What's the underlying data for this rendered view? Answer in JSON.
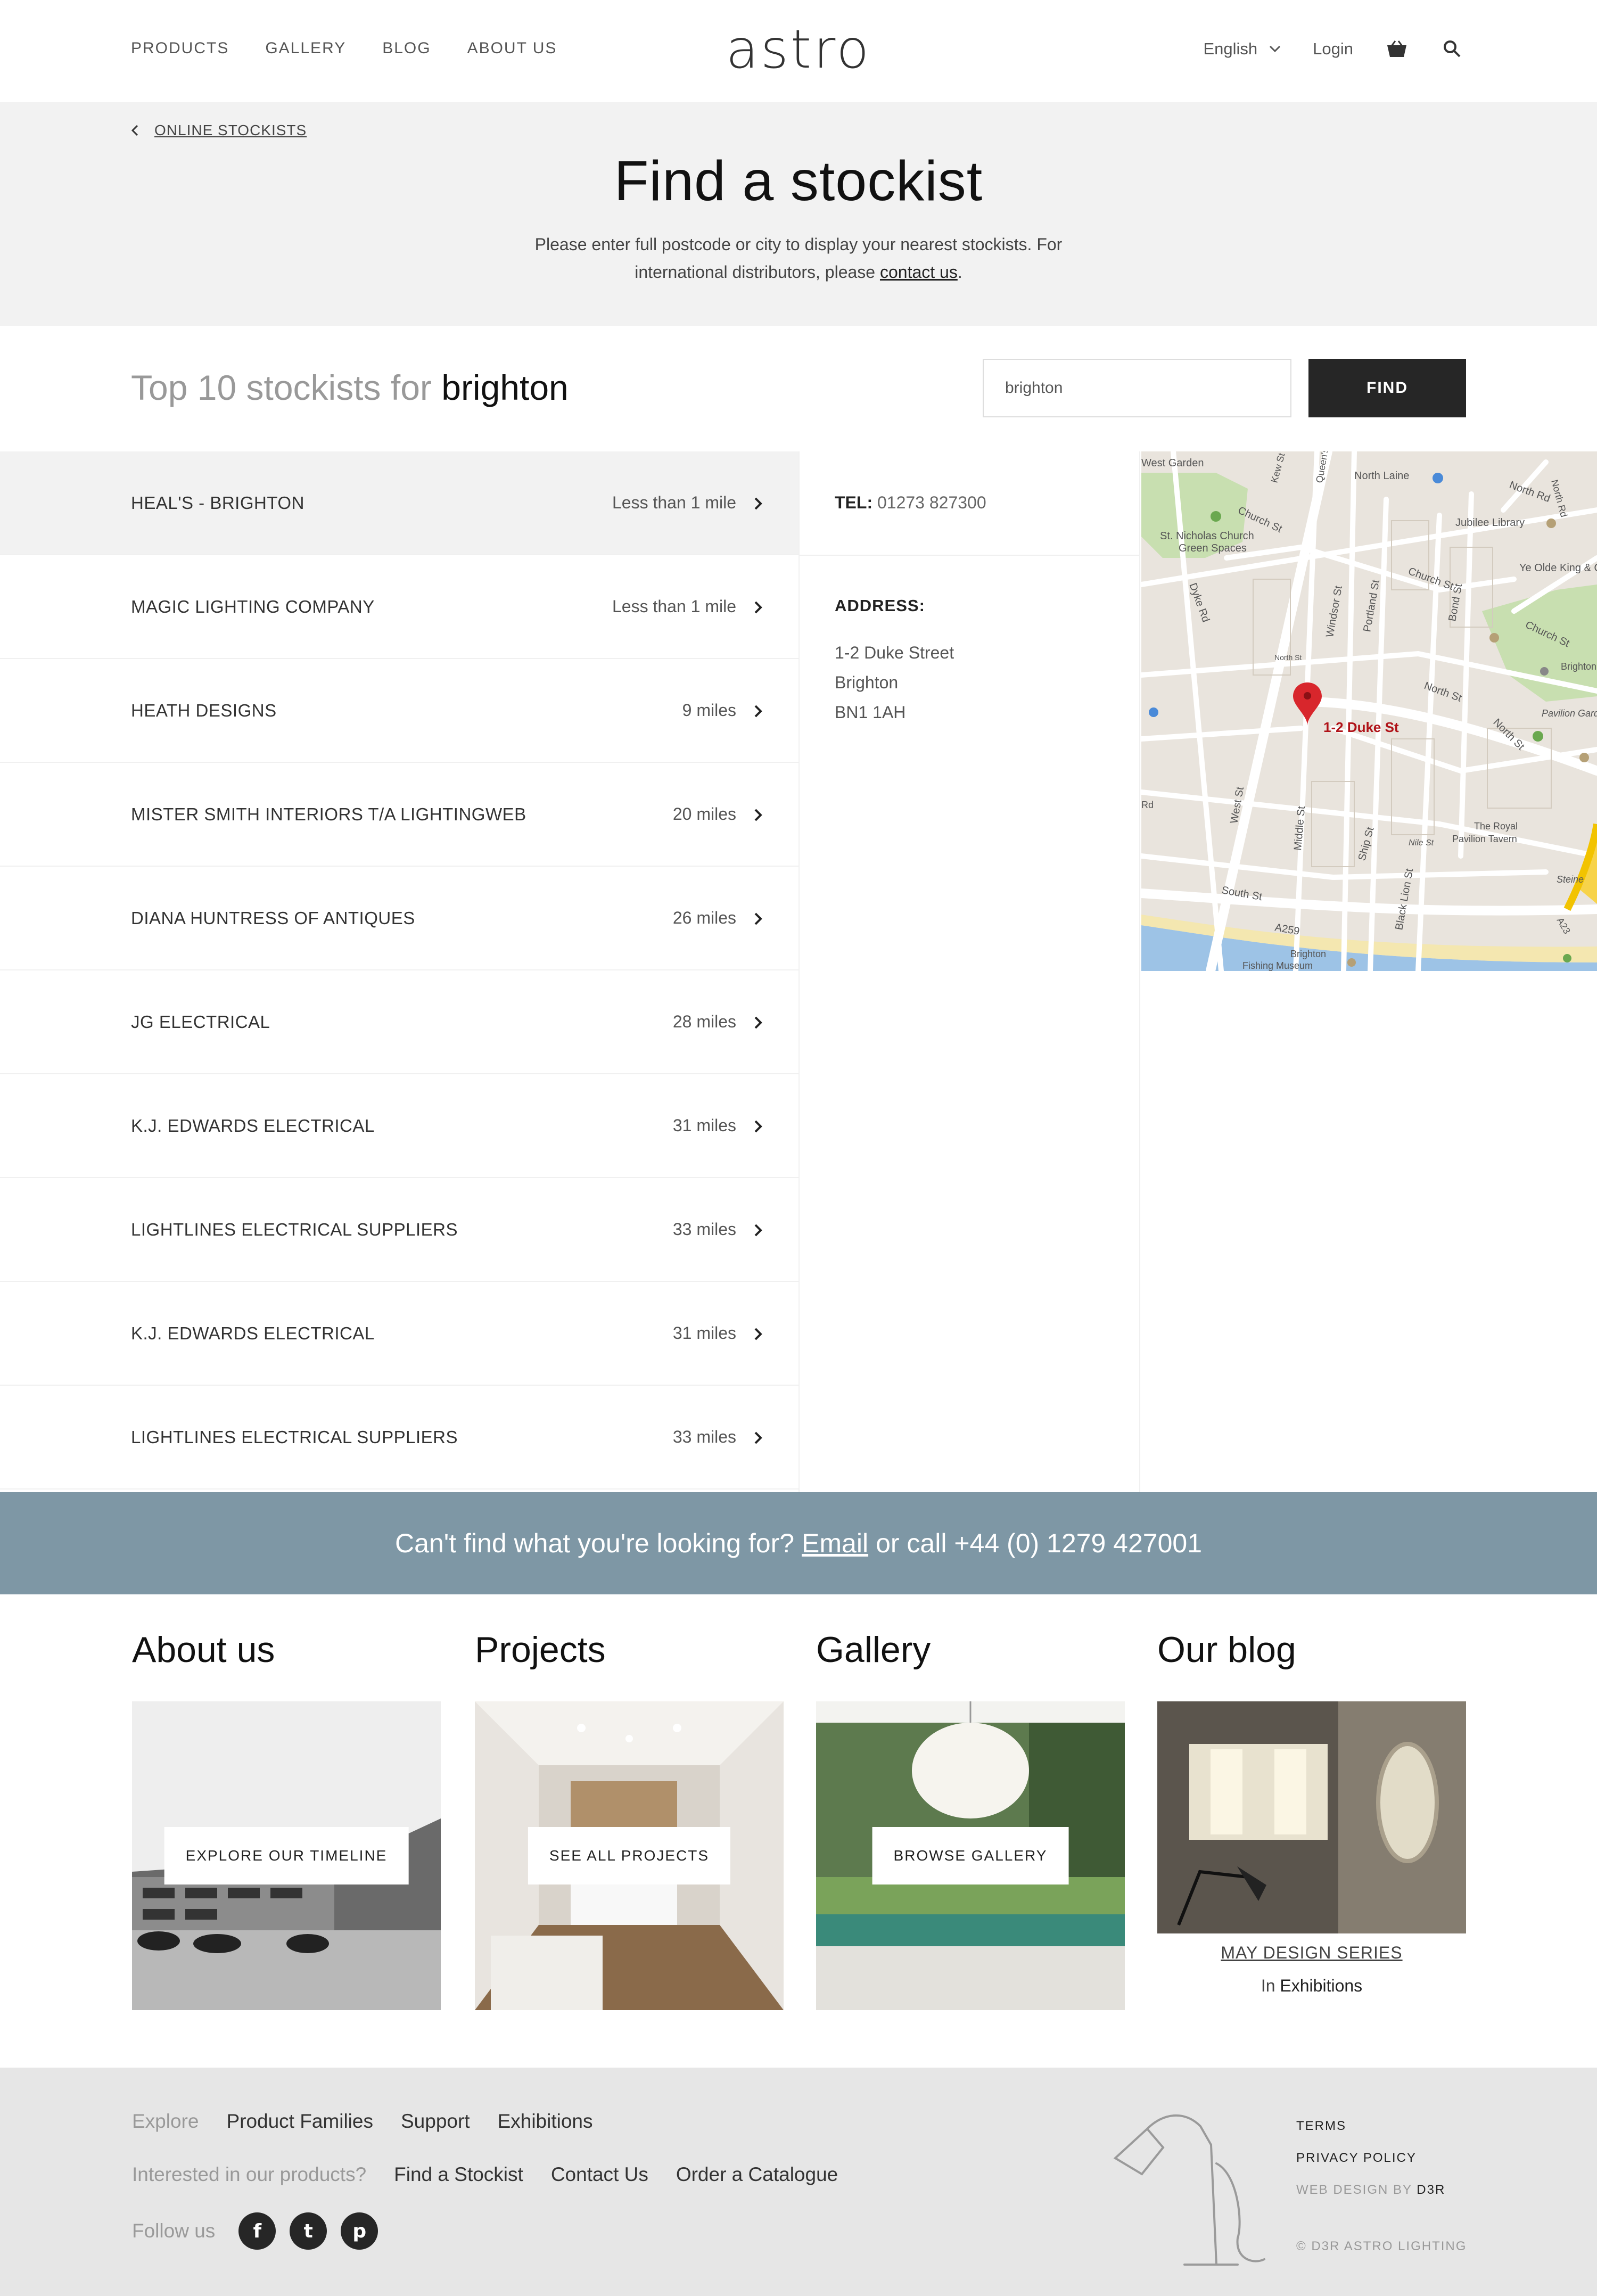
{
  "header": {
    "nav": [
      "PRODUCTS",
      "GALLERY",
      "BLOG",
      "ABOUT US"
    ],
    "logo": "astro",
    "language": "English",
    "login": "Login"
  },
  "hero": {
    "breadcrumb": "ONLINE STOCKISTS",
    "title": "Find a stockist",
    "intro_line1": "Please enter full postcode or city to display your nearest stockists. For",
    "intro_line2_prefix": "international distributors, please ",
    "intro_link": "contact us",
    "intro_suffix": "."
  },
  "results": {
    "title_prefix": "Top 10 stockists for",
    "query": "brighton",
    "input_value": "brighton",
    "find_label": "FIND"
  },
  "stockists": [
    {
      "name": "HEAL'S - BRIGHTON",
      "distance": "Less than 1 mile"
    },
    {
      "name": "MAGIC LIGHTING COMPANY",
      "distance": "Less than 1 mile"
    },
    {
      "name": "HEATH DESIGNS",
      "distance": "9 miles"
    },
    {
      "name": "MISTER SMITH INTERIORS T/A LIGHTINGWEB",
      "distance": "20 miles"
    },
    {
      "name": "DIANA HUNTRESS OF ANTIQUES",
      "distance": "26 miles"
    },
    {
      "name": "JG ELECTRICAL",
      "distance": "28 miles"
    },
    {
      "name": "K.J. EDWARDS ELECTRICAL",
      "distance": "31 miles"
    },
    {
      "name": "LIGHTLINES ELECTRICAL SUPPLIERS",
      "distance": "33 miles"
    },
    {
      "name": "K.J. EDWARDS ELECTRICAL",
      "distance": "31 miles"
    },
    {
      "name": "LIGHTLINES ELECTRICAL SUPPLIERS",
      "distance": "33 miles"
    }
  ],
  "detail": {
    "tel_label": "TEL:",
    "tel": "01273 827300",
    "address_label": "ADDRESS:",
    "address": [
      "1-2 Duke Street",
      "Brighton",
      "BN1 1AH"
    ]
  },
  "map": {
    "marker_label": "1-2 Duke St",
    "labels": {
      "west_garden": "West Garden",
      "north_laine": "North Laine",
      "north_rd": "North Rd",
      "church_st": "Church St",
      "st_nicholas_1": "St. Nicholas Church",
      "st_nicholas_2": "Green Spaces",
      "jubilee": "Jubilee Library",
      "ye_olde": "Ye Olde King & Queen",
      "dyke_rd": "Dyke Rd",
      "windsor_st": "Windsor St",
      "portland_st": "Portland St",
      "bond_st": "Bond St",
      "north_st": "North St",
      "pavilion_gardens": "Pavilion Gardens",
      "brighton": "Brighton",
      "west_st": "West St",
      "middle_st": "Middle St",
      "ship_st": "Ship St",
      "black_lion_st": "Black Lion St",
      "the_royal_1": "The Royal",
      "the_royal_2": "Pavilion Tavern",
      "nile_st": "Nile St",
      "south_st": "South St",
      "a259": "A259",
      "brighton_fishing_1": "Brighton",
      "brighton_fishing_2": "Fishing Museum",
      "steine": "Steine",
      "a23": "A23",
      "queens_rd": "Queen's Rd",
      "kew_st": "Kew St",
      "church_st_2": "Church St",
      "north_rd_2": "North Rd",
      "north_st_2": "North St",
      "rd": "Rd"
    }
  },
  "banner": {
    "prefix": "Can't find what you're looking for?",
    "email_link": "Email",
    "suffix": "or call +44 (0) 1279 427001"
  },
  "columns": {
    "about": {
      "title": "About us",
      "cta": "EXPLORE OUR TIMELINE"
    },
    "projects": {
      "title": "Projects",
      "cta": "SEE ALL PROJECTS"
    },
    "gallery": {
      "title": "Gallery",
      "cta": "BROWSE GALLERY"
    },
    "blog": {
      "title": "Our blog",
      "post_link": "MAY DESIGN SERIES",
      "category_prefix": "In",
      "category": "Exhibitions"
    }
  },
  "footer": {
    "explore_label": "Explore",
    "explore_links": [
      "Product Families",
      "Support",
      "Exhibitions"
    ],
    "interested_label": "Interested in our products?",
    "interested_links": [
      "Find a Stockist",
      "Contact Us",
      "Order a Catalogue"
    ],
    "follow_label": "Follow us",
    "social": {
      "facebook": "f",
      "twitter": "t",
      "pinterest": "p"
    },
    "terms": "TERMS",
    "privacy": "PRIVACY POLICY",
    "design_prefix": "WEB DESIGN BY",
    "design_by": "D3R",
    "copyright": "© D3R ASTRO LIGHTING"
  },
  "colors": {
    "banner": "#7e97a5",
    "find_button": "#262626",
    "hero_bg": "#f2f2f2",
    "footer_bg": "#e6e6e6",
    "map_pin": "#d8262c"
  },
  "icons": {
    "language": "chevron-down-icon",
    "cart": "basket-icon",
    "search": "search-icon",
    "breadcrumb": "chevron-left-icon",
    "row": "chevron-right-icon"
  }
}
